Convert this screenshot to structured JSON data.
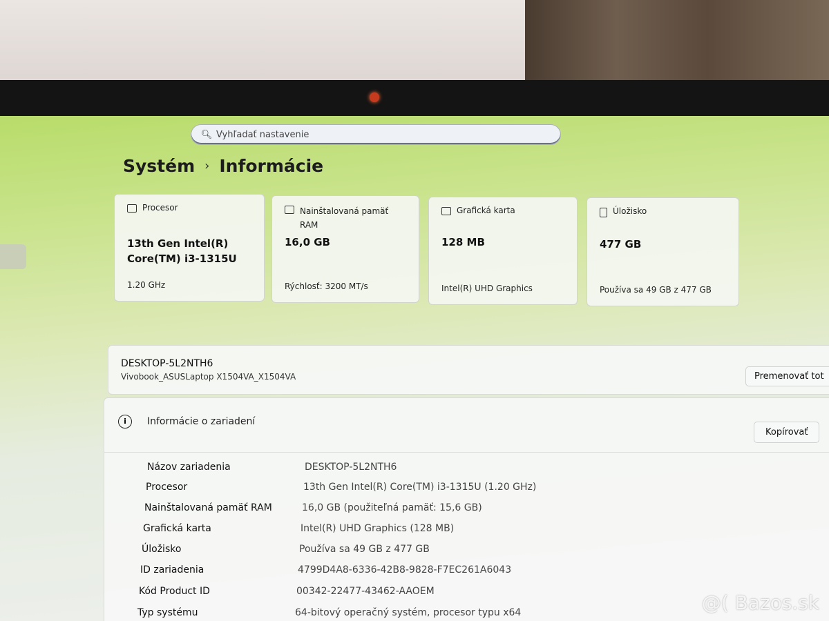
{
  "search": {
    "placeholder": "Vyhľadať nastavenie"
  },
  "breadcrumb": {
    "parent": "Systém",
    "separator": "›",
    "current": "Informácie"
  },
  "cards": [
    {
      "title": "Procesor",
      "value": "13th Gen Intel(R) Core(TM) i3-1315U",
      "sub": "1.20 GHz",
      "icon": "processor-icon"
    },
    {
      "title": "Nainštalovaná pamäť RAM",
      "value": "16,0 GB",
      "sub": "Rýchlosť: 3200 MT/s",
      "icon": "memory-icon"
    },
    {
      "title": "Grafická karta",
      "value": "128 MB",
      "sub": "Intel(R) UHD Graphics",
      "icon": "graphics-card-icon"
    },
    {
      "title": "Úložisko",
      "value": "477 GB",
      "sub": "Používa sa 49 GB z 477 GB",
      "icon": "storage-icon"
    }
  ],
  "device": {
    "name": "DESKTOP-5L2NTH6",
    "model": "Vivobook_ASUSLaptop X1504VA_X1504VA",
    "rename_label": "Premenovať tot"
  },
  "info": {
    "title": "Informácie o zariadení",
    "copy_label": "Kopírovať",
    "rows": [
      {
        "key": "Názov zariadenia",
        "value": "DESKTOP-5L2NTH6"
      },
      {
        "key": "Procesor",
        "value": "13th Gen Intel(R) Core(TM) i3-1315U (1.20 GHz)"
      },
      {
        "key": "Nainštalovaná pamäť RAM",
        "value": "16,0 GB (použiteľná pamäť: 15,6 GB)"
      },
      {
        "key": "Grafická karta",
        "value": "Intel(R) UHD Graphics (128 MB)"
      },
      {
        "key": "Úložisko",
        "value": "Používa sa 49 GB z 477 GB"
      },
      {
        "key": "ID zariadenia",
        "value": "4799D4A8-6336-42B8-9828-F7EC261A6043"
      },
      {
        "key": "Kód Product ID",
        "value": "00342-22477-43462-AAOEM"
      },
      {
        "key": "Typ systému",
        "value": "64-bitový operačný systém, procesor typu x64"
      }
    ]
  },
  "watermark": "@( Bazos.sk"
}
